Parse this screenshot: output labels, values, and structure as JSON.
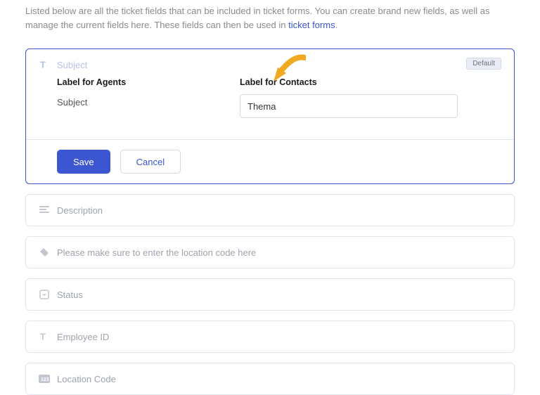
{
  "intro": {
    "text_before": "Listed below are all the ticket fields that can be included in ticket forms. You can create brand new fields, as well as manage the current fields here. These fields can then be used in ",
    "link_text": "ticket forms",
    "text_after": "."
  },
  "expanded_field": {
    "icon": "T",
    "title": "Subject",
    "badge": "Default",
    "label_agents_heading": "Label for Agents",
    "label_agents_value": "Subject",
    "label_contacts_heading": "Label for Contacts",
    "label_contacts_value": "Thema",
    "save_label": "Save",
    "cancel_label": "Cancel"
  },
  "collapsed_fields": [
    {
      "icon": "align-left",
      "title": "Description"
    },
    {
      "icon": "tag",
      "title": "Please make sure to enter the location code here"
    },
    {
      "icon": "dropdown",
      "title": "Status"
    },
    {
      "icon": "T",
      "title": "Employee ID"
    },
    {
      "icon": "number",
      "title": "Location Code"
    }
  ],
  "colors": {
    "accent": "#3c55d0",
    "muted": "#9ea3ad",
    "arrow": "#f2a922"
  }
}
